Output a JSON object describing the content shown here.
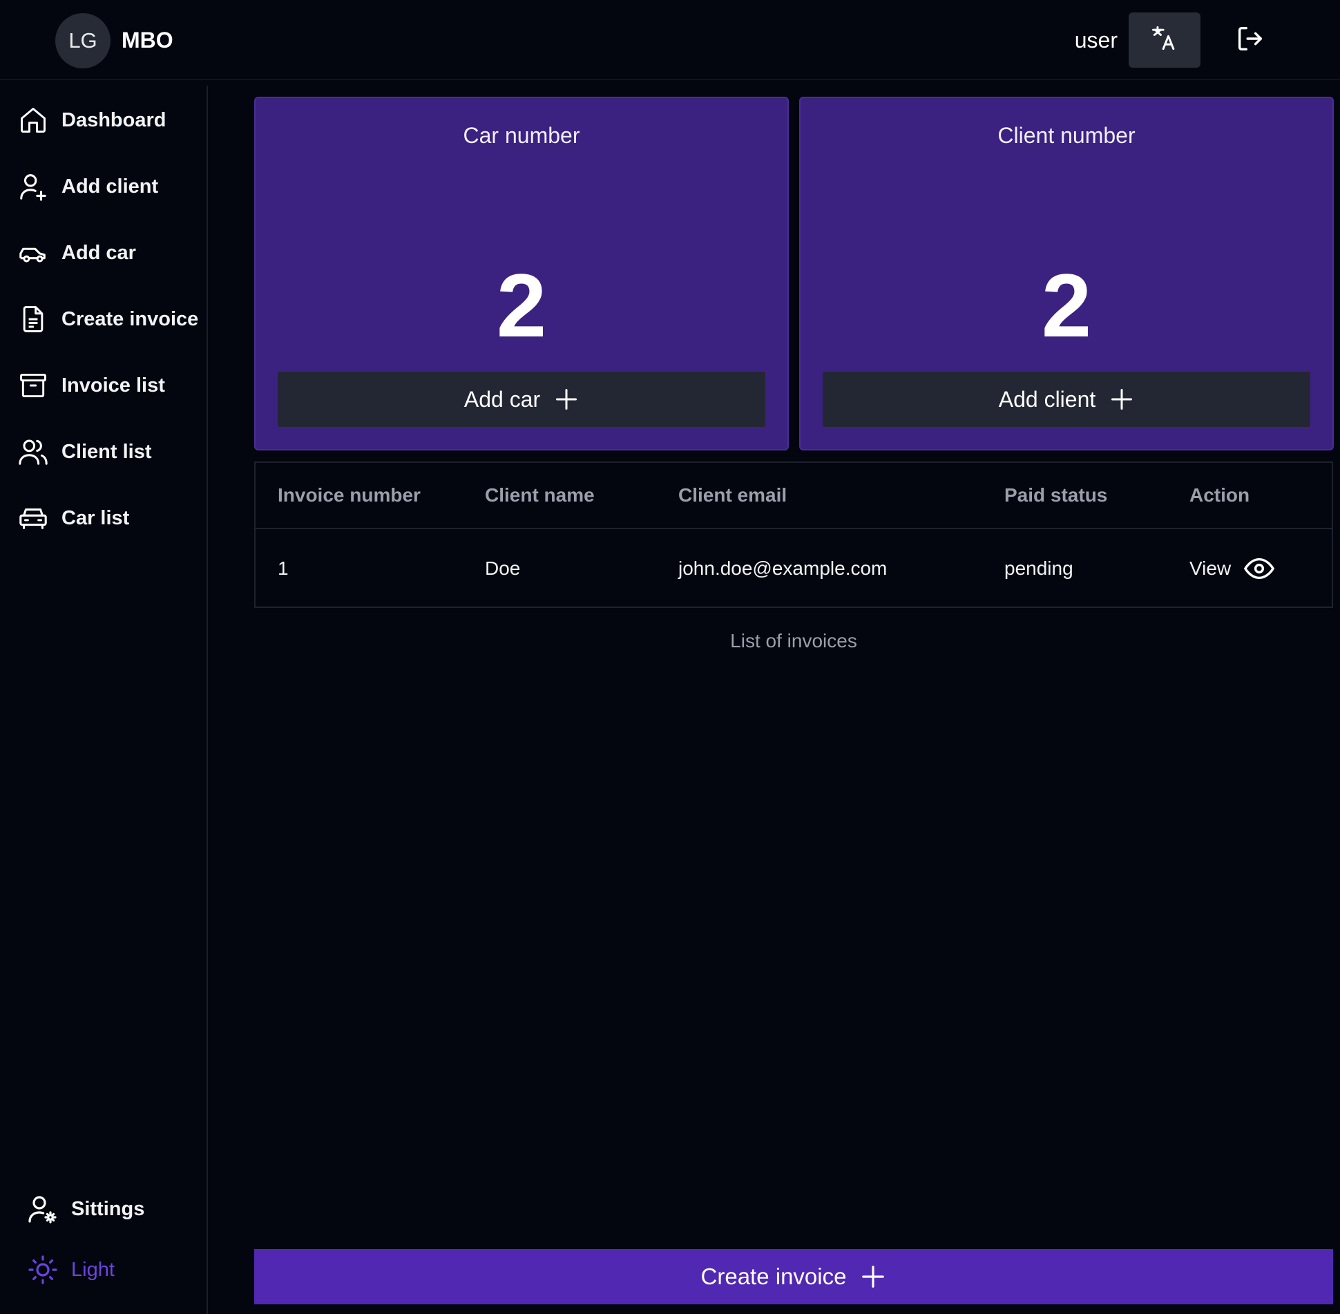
{
  "header": {
    "avatar_initials": "LG",
    "brand": "MBO",
    "username": "user",
    "translate_icon": "translate-icon",
    "logout_icon": "logout-icon"
  },
  "sidebar": {
    "items": [
      {
        "label": "Dashboard",
        "icon": "home-icon"
      },
      {
        "label": "Add client",
        "icon": "user-plus-icon"
      },
      {
        "label": "Add car",
        "icon": "car-icon"
      },
      {
        "label": "Create invoice",
        "icon": "document-icon"
      },
      {
        "label": "Invoice list",
        "icon": "archive-icon"
      },
      {
        "label": "Client list",
        "icon": "users-icon"
      },
      {
        "label": "Car list",
        "icon": "car-front-icon"
      }
    ],
    "bottom": [
      {
        "label": "Sittings",
        "icon": "user-gear-icon"
      },
      {
        "label": "Light",
        "icon": "sun-icon"
      }
    ]
  },
  "cards": [
    {
      "title": "Car number",
      "value": "2",
      "button_label": "Add car"
    },
    {
      "title": "Client number",
      "value": "2",
      "button_label": "Add client"
    }
  ],
  "table": {
    "headers": [
      "Invoice number",
      "Client name",
      "Client email",
      "Paid status",
      "Action"
    ],
    "rows": [
      {
        "invoice_number": "1",
        "client_name": "Doe",
        "client_email": "john.doe@example.com",
        "paid_status": "pending",
        "action": "View"
      }
    ],
    "caption": "List of invoices"
  },
  "create_invoice": {
    "label": "Create invoice"
  },
  "colors": {
    "background": "#03060f",
    "card": "#3b2180",
    "card_button": "#232733",
    "accent": "#5128b1",
    "light_mode_text": "#6d43e0",
    "muted_text": "#9a9fab"
  }
}
